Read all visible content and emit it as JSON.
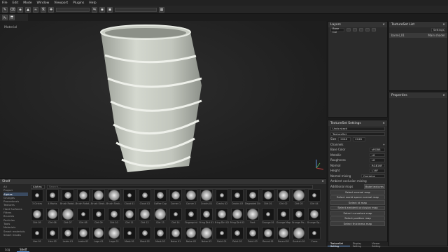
{
  "menu": [
    "File",
    "Edit",
    "Mode",
    "Window",
    "Viewport",
    "Plugins",
    "Help"
  ],
  "viewport": {
    "label": "Material"
  },
  "layers": {
    "title": "Layers",
    "blend_mode": "Base Col",
    "layer_name": "Fill layer 1"
  },
  "textureset_list": {
    "title": "TextureSet List",
    "settings_label": "Settings",
    "item": "barrel_01",
    "item_shader": "Main shader"
  },
  "properties": {
    "title": "Properties"
  },
  "textureset_settings": {
    "title": "TextureSet Settings",
    "undo_stack": "Undo stack",
    "textureset_label": "TextureSet",
    "size_label": "Size",
    "size_value": "2048",
    "size_value2": "2048",
    "channels_label": "Channels",
    "channels": [
      {
        "name": "Base Color",
        "format": "sRGB8"
      },
      {
        "name": "Metallic",
        "format": "L8"
      },
      {
        "name": "Roughness",
        "format": "L8"
      },
      {
        "name": "Normal",
        "format": "RGB16F"
      },
      {
        "name": "Height",
        "format": "L16F"
      }
    ],
    "normal_mixing_label": "Normal mixing",
    "normal_mixing_value": "Combine",
    "ao_mixing_label": "Ambient occlusion mixing",
    "additional_maps_label": "Additional maps",
    "bake_button": "Bake textures",
    "map_buttons": [
      "Select normal map",
      "Select world space normal map",
      "Select id map",
      "Select ambient occlusion map",
      "Select curvature map",
      "Select position map",
      "Select thickness map"
    ]
  },
  "shelf": {
    "title": "Shelf",
    "search_placeholder": "Search...",
    "filter_label": "Alphas",
    "categories": [
      "All",
      "Project",
      "Alphas",
      "Grunges",
      "Procedurals",
      "Textures",
      "Hard Surfaces",
      "Filters",
      "Brushes",
      "Particles",
      "Tools",
      "Materials",
      "Smart materials",
      "Smart masks"
    ],
    "row1": [
      "3 Circles",
      "4 Marks",
      "Brush Rotat...",
      "Brush Rotat...",
      "Brush Strok...",
      "Brush Strok...",
      "Cloud 01",
      "Cloud 02",
      "Coffee Cup",
      "Corner 1",
      "Corner 2",
      "Cracks 01",
      "Cracks 02",
      "Cracks 03",
      "Degraded Dir...",
      "Dirt 01",
      "Dirt 02",
      "Dirt 03",
      "Dirt 04"
    ],
    "row2": [
      "Dirt 05",
      "Dirt 06",
      "Dirt 07",
      "Dirt 08",
      "Dirt 09",
      "Dirt 10",
      "Dirt 11",
      "Dirt 12",
      "Dirt 13",
      "Dirt 14",
      "Fingerprint",
      "Fring Dirt 01",
      "Fring Dirt 02",
      "Fring Dirt 03",
      "Font",
      "Grunge 01",
      "Grunge Map",
      "Grunge Pa...",
      "Grunge Sq..."
    ],
    "row3": [
      "Hex 01",
      "Hex 02",
      "Leaks 01",
      "Leaks 02",
      "Logo 01",
      "Logo 02",
      "Mask 01",
      "Mask 02",
      "Mask 03",
      "Noise 01",
      "Noise 02",
      "Noise 03",
      "Paint 01",
      "Paint 02",
      "Paint 03",
      "Round 01",
      "Round 02",
      "Scratch 01",
      "Cross"
    ]
  },
  "status": {
    "log": "Log",
    "shelf_tab": "Shelf"
  },
  "bottom_tabs": [
    "TextureSet Setting",
    "Display Setting",
    "Viewer Setting"
  ],
  "colors": {
    "accent": "#5a8fd0",
    "panel": "#2b2b2b",
    "bg": "#1c1c1c",
    "barrel": "#c8ccc4"
  }
}
